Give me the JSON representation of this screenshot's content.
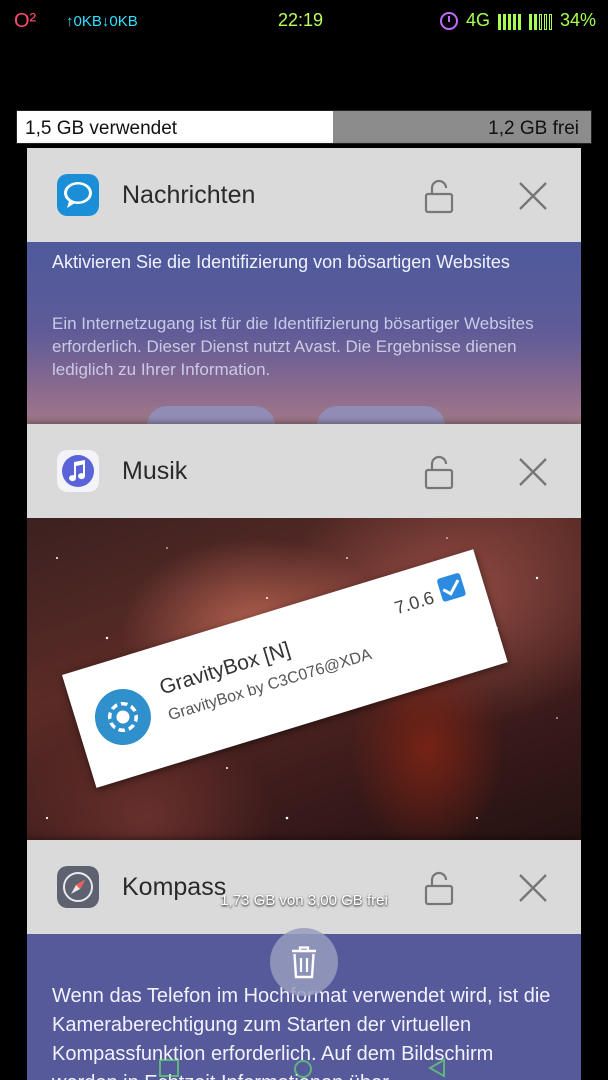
{
  "status_bar": {
    "carrier": "O²",
    "network_speed": "↑0KB↓0KB",
    "time": "22:19",
    "network_type": "4G",
    "battery": "34%"
  },
  "memory_bar": {
    "used_label": "1,5 GB verwendet",
    "free_label": "1,2 GB frei",
    "used_fraction": 0.55
  },
  "cards": [
    {
      "app_name": "Nachrichten",
      "icon": "messages-icon",
      "content_title": "Aktivieren Sie die Identifizierung von bösartigen Websites",
      "content_text": "Ein Internetzugang ist für die Identifizierung bösartiger Websites erforderlich. Dieser Dienst nutzt Avast. Die Ergebnisse dienen lediglich zu Ihrer Information."
    },
    {
      "app_name": "Musik",
      "icon": "music-icon",
      "overlay": {
        "title": "GravityBox [N]",
        "subtitle": "GravityBox by C3C076@XDA",
        "version": "7.0.6",
        "checked": true
      }
    },
    {
      "app_name": "Kompass",
      "icon": "compass-icon",
      "content_text": "Wenn das Telefon im Hochformat verwendet wird, ist die Kameraberechtigung zum Starten der virtuellen Kompassfunktion erforderlich. Auf dem Bildschirm werden in Echtzeit Informationen über"
    }
  ],
  "free_memory_label": "1,73 GB von 3,00 GB frei",
  "colors": {
    "accent_arrow": "#f08a2c",
    "carrier": "#ff4a6e",
    "status_green": "#a6ff4d"
  }
}
